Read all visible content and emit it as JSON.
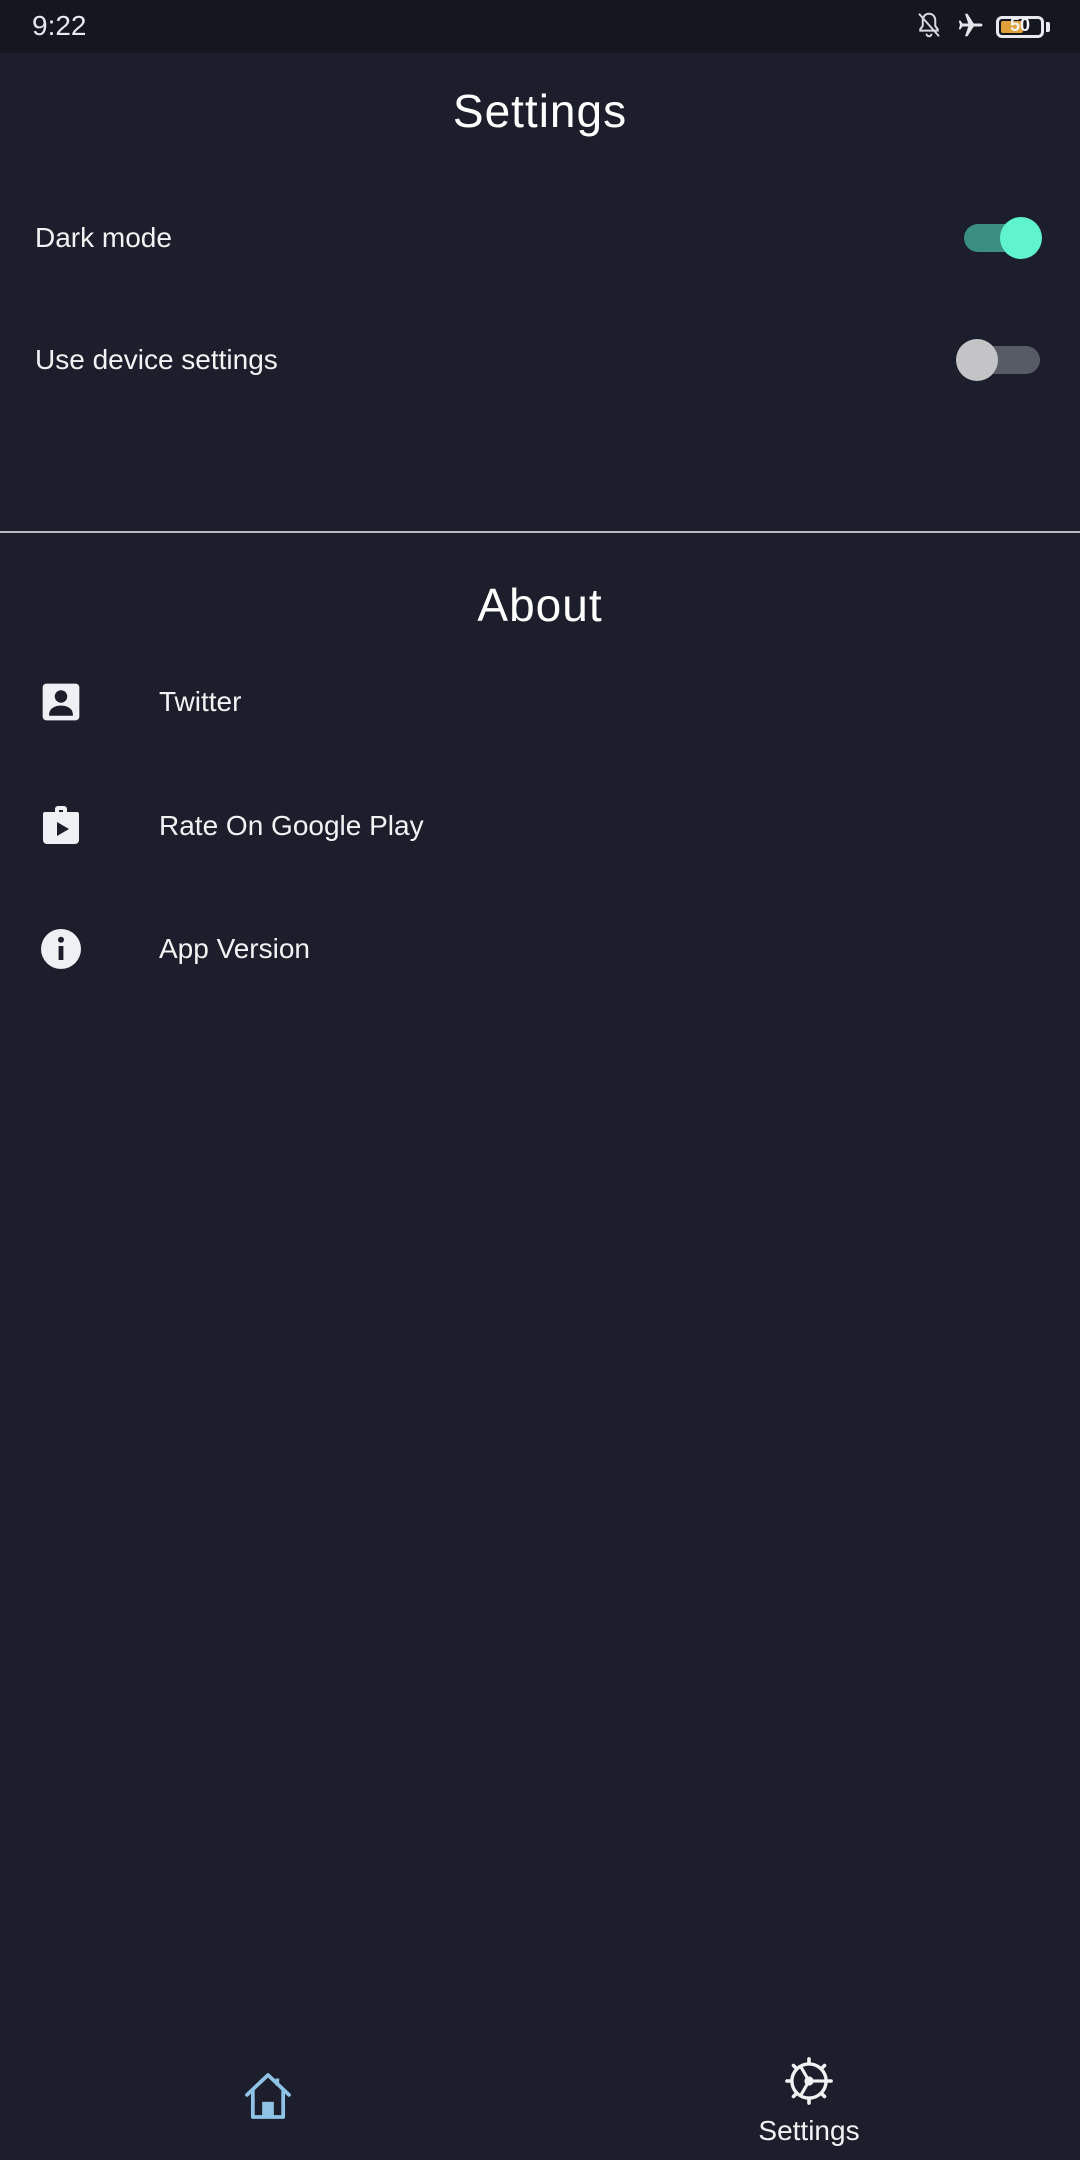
{
  "status_bar": {
    "time": "9:22",
    "battery_level": "50",
    "icons": [
      "bell-off-icon",
      "airplane-icon",
      "battery-icon"
    ]
  },
  "settings": {
    "title": "Settings",
    "dark_mode": {
      "label": "Dark mode",
      "enabled": true
    },
    "use_device": {
      "label": "Use device settings",
      "enabled": false
    }
  },
  "about": {
    "title": "About",
    "items": [
      {
        "label": "Twitter",
        "icon": "account-box-icon"
      },
      {
        "label": "Rate On Google Play",
        "icon": "shop-play-icon"
      },
      {
        "label": "App Version",
        "icon": "info-icon"
      }
    ]
  },
  "nav": {
    "home": {
      "label": "",
      "icon": "home-icon"
    },
    "settings": {
      "label": "Settings",
      "icon": "settings-wheel-icon"
    }
  },
  "colors": {
    "background": "#1c1f2b",
    "status_bar": "#141720",
    "accent": "#5ff4ce",
    "accent_track": "#3b8f82",
    "home_icon": "#8fc3e6"
  }
}
